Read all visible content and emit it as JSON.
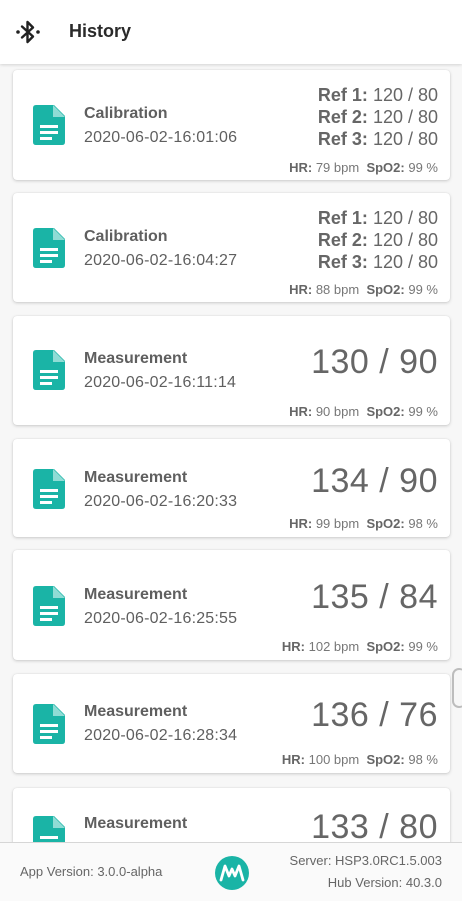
{
  "header": {
    "icon": "bluetooth-icon",
    "title": "History"
  },
  "records": [
    {
      "type": "Calibration",
      "timestamp": "2020-06-02-16:01:06",
      "refs": [
        {
          "label": "Ref 1:",
          "value": "120 / 80"
        },
        {
          "label": "Ref 2:",
          "value": "120 / 80"
        },
        {
          "label": "Ref 3:",
          "value": "120 / 80"
        }
      ],
      "hr_label": "HR:",
      "hr_value": "79 bpm",
      "spo2_label": "SpO2:",
      "spo2_value": "99 %"
    },
    {
      "type": "Calibration",
      "timestamp": "2020-06-02-16:04:27",
      "refs": [
        {
          "label": "Ref 1:",
          "value": "120 / 80"
        },
        {
          "label": "Ref 2:",
          "value": "120 / 80"
        },
        {
          "label": "Ref 3:",
          "value": "120 / 80"
        }
      ],
      "hr_label": "HR:",
      "hr_value": "88 bpm",
      "spo2_label": "SpO2:",
      "spo2_value": "99 %"
    },
    {
      "type": "Measurement",
      "timestamp": "2020-06-02-16:11:14",
      "bp": "130 / 90",
      "hr_label": "HR:",
      "hr_value": "90 bpm",
      "spo2_label": "SpO2:",
      "spo2_value": "99 %"
    },
    {
      "type": "Measurement",
      "timestamp": "2020-06-02-16:20:33",
      "bp": "134 / 90",
      "hr_label": "HR:",
      "hr_value": "99 bpm",
      "spo2_label": "SpO2:",
      "spo2_value": "98 %"
    },
    {
      "type": "Measurement",
      "timestamp": "2020-06-02-16:25:55",
      "bp": "135 / 84",
      "hr_label": "HR:",
      "hr_value": "102 bpm",
      "spo2_label": "SpO2:",
      "spo2_value": "99 %"
    },
    {
      "type": "Measurement",
      "timestamp": "2020-06-02-16:28:34",
      "bp": "136 / 76",
      "hr_label": "HR:",
      "hr_value": "100 bpm",
      "spo2_label": "SpO2:",
      "spo2_value": "98 %"
    },
    {
      "type": "Measurement",
      "bp": "133 / 80"
    }
  ],
  "footer": {
    "app_version": "App Version: 3.0.0-alpha",
    "logo": "maxim-logo",
    "server_version": "Server: HSP3.0RC1.5.003",
    "hub_version": "Hub Version: 40.3.0"
  },
  "colors": {
    "accent": "#1ab4a6",
    "text": "#5f5f5f"
  }
}
